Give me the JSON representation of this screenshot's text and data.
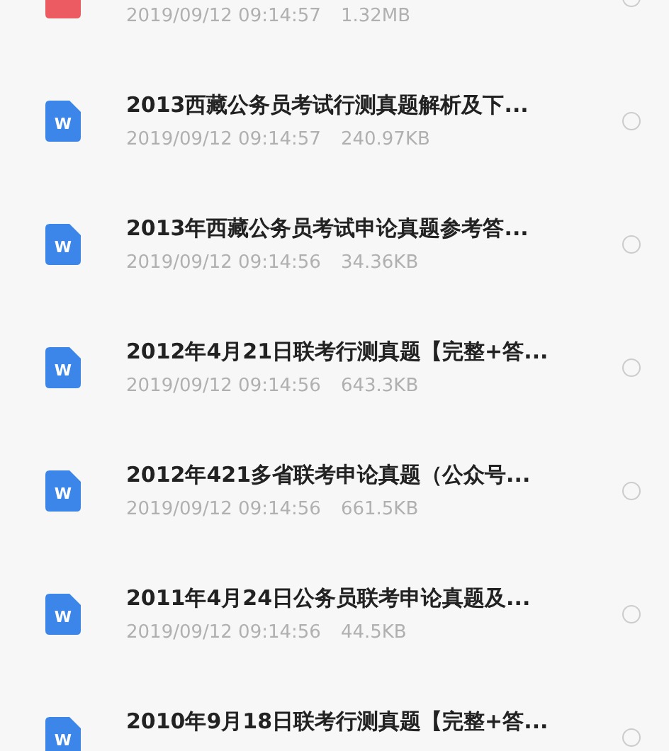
{
  "files": [
    {
      "kind": "pdf",
      "date": "2019/09/12 09:14:57",
      "size": "1.32MB",
      "selected": false
    },
    {
      "kind": "word",
      "icon_letter": "W",
      "title": "2013西藏公务员考试行测真题解析及下...",
      "date": "2019/09/12 09:14:57",
      "size": "240.97KB",
      "selected": false
    },
    {
      "kind": "word",
      "icon_letter": "W",
      "title": "2013年西藏公务员考试申论真题参考答...",
      "date": "2019/09/12 09:14:56",
      "size": "34.36KB",
      "selected": false
    },
    {
      "kind": "word",
      "icon_letter": "W",
      "title": "2012年4月21日联考行测真题【完整+答...",
      "date": "2019/09/12 09:14:56",
      "size": "643.3KB",
      "selected": false
    },
    {
      "kind": "word",
      "icon_letter": "W",
      "title": "2012年421多省联考申论真题（公众号...",
      "date": "2019/09/12 09:14:56",
      "size": "661.5KB",
      "selected": false
    },
    {
      "kind": "word",
      "icon_letter": "W",
      "title": "2011年4月24日公务员联考申论真题及...",
      "date": "2019/09/12 09:14:56",
      "size": "44.5KB",
      "selected": false
    },
    {
      "kind": "word",
      "icon_letter": "W",
      "title": "2010年9月18日联考行测真题【完整+答...",
      "selected": false
    }
  ]
}
